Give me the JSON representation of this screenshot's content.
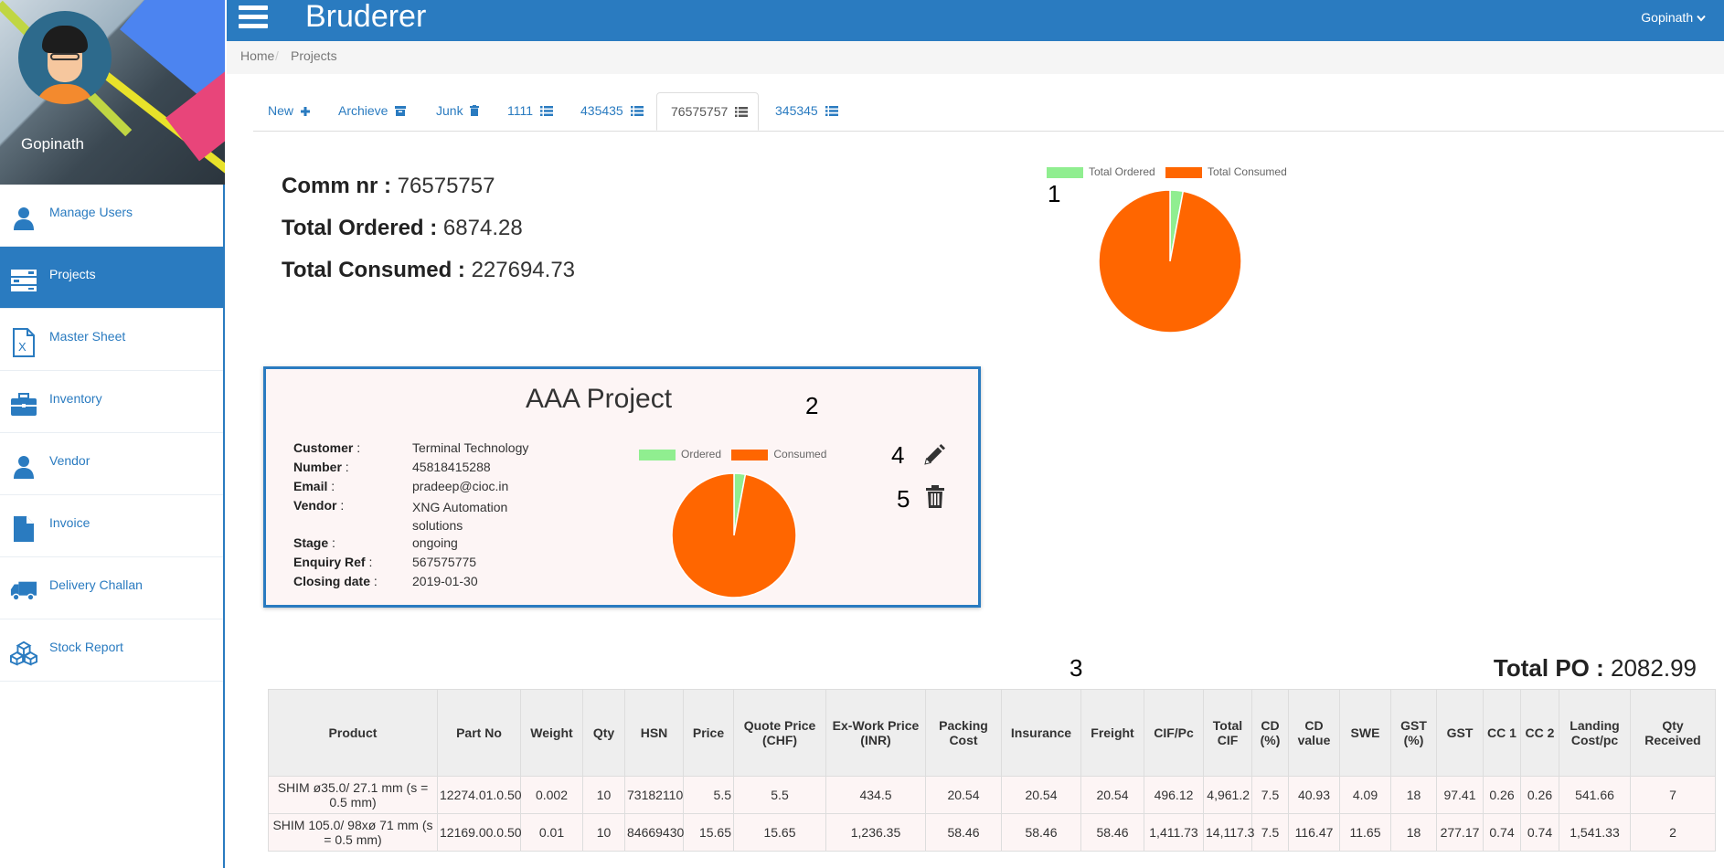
{
  "app": {
    "title": "Bruderer",
    "user_menu": "Gopinath"
  },
  "profile": {
    "name": "Gopinath"
  },
  "sidebar": {
    "items": [
      {
        "label": "Manage Users",
        "icon": "user-icon"
      },
      {
        "label": "Projects",
        "icon": "server-icon",
        "active": true
      },
      {
        "label": "Master Sheet",
        "icon": "excel-file-icon"
      },
      {
        "label": "Inventory",
        "icon": "briefcase-icon"
      },
      {
        "label": "Vendor",
        "icon": "user-icon"
      },
      {
        "label": "Invoice",
        "icon": "file-icon"
      },
      {
        "label": "Delivery Challan",
        "icon": "truck-icon"
      },
      {
        "label": "Stock Report",
        "icon": "cubes-icon"
      }
    ]
  },
  "breadcrumb": {
    "home": "Home",
    "separator": "/",
    "current": "Projects"
  },
  "tabs": [
    {
      "label": "New",
      "icon": "plus-icon"
    },
    {
      "label": "Archieve",
      "icon": "archive-icon"
    },
    {
      "label": "Junk",
      "icon": "trash-icon"
    },
    {
      "label": "1111",
      "icon": "list-icon"
    },
    {
      "label": "435435",
      "icon": "list-icon"
    },
    {
      "label": "76575757",
      "icon": "list-icon",
      "active": true
    },
    {
      "label": "345345",
      "icon": "list-icon"
    }
  ],
  "summary": {
    "comm_label": "Comm nr :",
    "comm_value": "76575757",
    "ordered_label": "Total Ordered :",
    "ordered_value": "6874.28",
    "consumed_label": "Total Consumed :",
    "consumed_value": "227694.73"
  },
  "colors": {
    "ordered": "#90ee90",
    "consumed": "#ff6600",
    "accent": "#2a7bc0"
  },
  "chart_data": [
    {
      "type": "pie",
      "categories": [
        "Total Ordered",
        "Total Consumed"
      ],
      "values": [
        6874.28,
        227694.73
      ],
      "legend": "top"
    },
    {
      "type": "pie",
      "categories": [
        "Ordered",
        "Consumed"
      ],
      "values": [
        6874.28,
        227694.73
      ],
      "legend": "top"
    }
  ],
  "annotations": {
    "a1": "1",
    "a2": "2",
    "a3": "3",
    "a4": "4",
    "a5": "5"
  },
  "project": {
    "title": "AAA Project",
    "details": [
      {
        "key": "Customer",
        "value": "Terminal Technology"
      },
      {
        "key": "Number",
        "value": "45818415288"
      },
      {
        "key": "Email",
        "value": "pradeep@cioc.in"
      },
      {
        "key": "Vendor",
        "value": "XNG Automation solutions"
      },
      {
        "key": "Stage",
        "value": "ongoing"
      },
      {
        "key": "Enquiry Ref",
        "value": "567575775"
      },
      {
        "key": "Closing date",
        "value": "2019-01-30"
      }
    ]
  },
  "total_po": {
    "label": "Total PO :",
    "value": "2082.99"
  },
  "table": {
    "headers": [
      "Product",
      "Part No",
      "Weight",
      "Qty",
      "HSN",
      "Price",
      "Quote Price (CHF)",
      "Ex-Work Price (INR)",
      "Packing Cost",
      "Insurance",
      "Freight",
      "CIF/Pc",
      "Total CIF",
      "CD (%)",
      "CD value",
      "SWE",
      "GST (%)",
      "GST",
      "CC 1",
      "CC 2",
      "Landing Cost/pc",
      "Qty Received"
    ],
    "rows": [
      [
        "SHIM ø35.0/ 27.1 mm  (s = 0.5 mm)",
        "12274.01.0.50",
        "0.002",
        "10",
        "73182110",
        "5.5",
        "5.5",
        "434.5",
        "20.54",
        "20.54",
        "20.54",
        "496.12",
        "4,961.2",
        "7.5",
        "40.93",
        "4.09",
        "18",
        "97.41",
        "0.26",
        "0.26",
        "541.66",
        "7"
      ],
      [
        "SHIM 105.0/ 98xø 71 mm  (s = 0.5 mm)",
        "12169.00.0.50",
        "0.01",
        "10",
        "84669430",
        "15.65",
        "15.65",
        "1,236.35",
        "58.46",
        "58.46",
        "58.46",
        "1,411.73",
        "14,117.3",
        "7.5",
        "116.47",
        "11.65",
        "18",
        "277.17",
        "0.74",
        "0.74",
        "1,541.33",
        "2"
      ]
    ]
  }
}
